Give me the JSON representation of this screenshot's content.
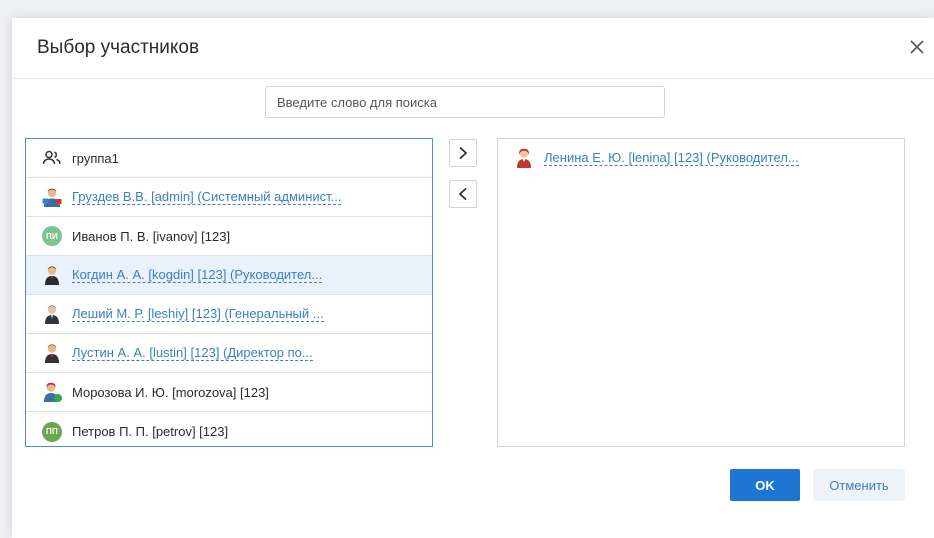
{
  "dialog": {
    "title": "Выбор участников",
    "search_placeholder": "Введите слово для поиска",
    "ok_label": "OK",
    "cancel_label": "Отменить"
  },
  "available": [
    {
      "label": "группа1",
      "icon": "group-icon",
      "link": false
    },
    {
      "label": "Груздев В.В. [admin] (Системный админист...",
      "icon": "admin-avatar-icon",
      "link": true
    },
    {
      "label": "Иванов П. В. [ivanov] [123]",
      "icon": "initials-avatar",
      "initials": "ПИ",
      "color": "#7cc48e",
      "link": false
    },
    {
      "label": "Когдин А. А. [kogdin] [123] (Руководител...",
      "icon": "user-avatar-icon",
      "link": true,
      "selected": true
    },
    {
      "label": "Леший М. Р. [leshiy] [123] (Генеральный ...",
      "icon": "user-avatar-icon",
      "link": true
    },
    {
      "label": "Лустин А. А. [lustin] [123] (Директор по...",
      "icon": "user-avatar-icon",
      "link": true
    },
    {
      "label": "Морозова И. Ю. [morozova] [123]",
      "icon": "user-avatar-icon",
      "link": false
    },
    {
      "label": "Петров П. П. [petrov] [123]",
      "icon": "initials-avatar",
      "initials": "ПП",
      "color": "#6aa84f",
      "link": false
    }
  ],
  "chosen": [
    {
      "label": "Ленина Е. Ю. [lenina] [123] (Руководител...",
      "icon": "female-avatar-icon",
      "link": true
    }
  ],
  "colors": {
    "accent": "#1f76d2",
    "link": "#3a7ec6",
    "selected_row": "#e9f1fa"
  }
}
